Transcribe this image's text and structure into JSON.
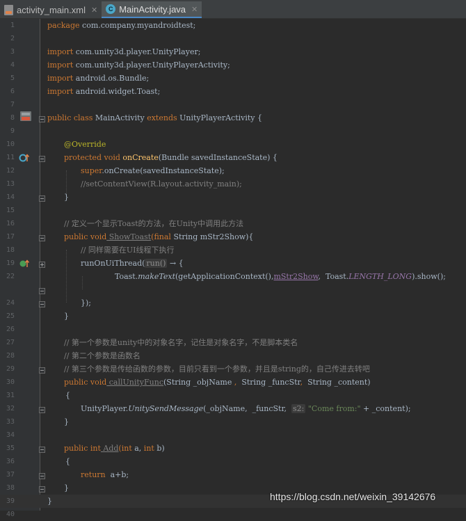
{
  "tabs": [
    {
      "label": "activity_main.xml",
      "active": false
    },
    {
      "label": "MainActivity.java",
      "active": true
    }
  ],
  "watermark": "https://blog.csdn.net/weixin_39142676",
  "colors": {
    "keyword": "#cc7832",
    "annotation": "#bbb529",
    "method": "#ffc66d",
    "comment": "#808080",
    "string": "#6a8759",
    "constant": "#9876aa",
    "text": "#a9b7c6"
  },
  "lines": [
    {
      "n": "1"
    },
    {
      "n": "2"
    },
    {
      "n": "3"
    },
    {
      "n": "4"
    },
    {
      "n": "5"
    },
    {
      "n": "6"
    },
    {
      "n": "7"
    },
    {
      "n": "8"
    },
    {
      "n": "9"
    },
    {
      "n": "10"
    },
    {
      "n": "11"
    },
    {
      "n": "12"
    },
    {
      "n": "13"
    },
    {
      "n": "14"
    },
    {
      "n": "15"
    },
    {
      "n": "16"
    },
    {
      "n": "17"
    },
    {
      "n": "18"
    },
    {
      "n": "19"
    },
    {
      "n": "22"
    },
    {
      "n": "24"
    },
    {
      "n": "25"
    },
    {
      "n": "26"
    },
    {
      "n": "27"
    },
    {
      "n": "28"
    },
    {
      "n": "29"
    },
    {
      "n": "30"
    },
    {
      "n": "31"
    },
    {
      "n": "32"
    },
    {
      "n": "33"
    },
    {
      "n": "34"
    },
    {
      "n": "35"
    },
    {
      "n": "36"
    },
    {
      "n": "37"
    },
    {
      "n": "38"
    },
    {
      "n": "39"
    },
    {
      "n": "40"
    }
  ],
  "code": {
    "l1": {
      "kw": "package",
      "rest": " com.company.myandroidtest;"
    },
    "l3": {
      "kw": "import",
      "rest": " com.unity3d.player.UnityPlayer;"
    },
    "l4": {
      "kw": "import",
      "rest": " com.unity3d.player.UnityPlayerActivity;"
    },
    "l5": {
      "kw": "import",
      "rest": " android.os.Bundle;"
    },
    "l6": {
      "kw": "import",
      "rest": " android.widget.Toast;"
    },
    "l8": {
      "kw1": "public class",
      "name": " MainActivity ",
      "kw2": "extends",
      "rest": " UnityPlayerActivity {"
    },
    "l10": {
      "ann": "@Override"
    },
    "l11": {
      "kw": "protected void",
      "fn": " onCreate",
      "rest": "(Bundle savedInstanceState) {"
    },
    "l12": {
      "kw": "super",
      "rest": ".onCreate(savedInstanceState);"
    },
    "l13": {
      "cmt": "//setContentView(R.layout.activity_main);"
    },
    "l14": {
      "rest": "}"
    },
    "l16": {
      "cmt": "// 定义一个显示Toast的方法，在Unity中调用此方法"
    },
    "l17": {
      "kw": "public void",
      "fn": " ShowToast",
      "kw2": "(final",
      "rest": " String mStr2Show){"
    },
    "l18": {
      "cmt": "// 同样需要在UI线程下执行"
    },
    "l19": {
      "pre": "runOnUiThread(",
      "hint": "run()",
      "rest": " → {"
    },
    "l22": {
      "pre": "Toast.",
      "stat": "makeText",
      "mid": "(getApplicationContext(),",
      "und": "mStr2Show",
      "mid2": ",  Toast.",
      "const": "LENGTH_LONG",
      "rest": ").show();"
    },
    "l24": {
      "rest": "});"
    },
    "l25": {
      "rest": "}"
    },
    "l27": {
      "cmt": "// 第一个参数是unity中的对象名字，记住是对象名字，不是脚本类名"
    },
    "l28": {
      "cmt": "// 第二个参数是函数名"
    },
    "l29": {
      "cmt": "// 第三个参数是传给函数的参数，目前只看到一个参数，并且是string的，自己传进去转吧"
    },
    "l30": {
      "kw": "public void",
      "fn": " callUnityFunc",
      "p1": "(String _objName ",
      "comma": ",",
      "p2": "  String _funcStr",
      "comma2": ",",
      "p3": "  String _content)"
    },
    "l31": {
      "rest": "{"
    },
    "l32": {
      "pre": "UnityPlayer.",
      "stat": "UnitySendMessage",
      "mid": "(_objName,  _funcStr,  ",
      "hint": "s2:",
      "str": " \"Come from:\"",
      "rest": " + _content);"
    },
    "l33": {
      "rest": "}"
    },
    "l35": {
      "kw": "public int",
      "fn": " Add",
      "kw2": "(int",
      "mid": " a,",
      "kw3": " int",
      "rest": " b)"
    },
    "l36": {
      "rest": "{"
    },
    "l37": {
      "kw": "return",
      "rest": "  a+b;"
    },
    "l38": {
      "rest": "}"
    },
    "l39": {
      "rest": "}"
    }
  }
}
